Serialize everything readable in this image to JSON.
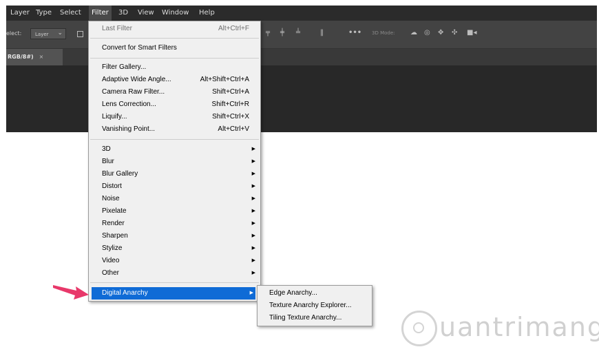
{
  "menubar": [
    "Layer",
    "Type",
    "Select",
    "Filter",
    "3D",
    "View",
    "Window",
    "Help"
  ],
  "options_bar": {
    "select_label": "elect:",
    "select_value": "Layer",
    "mode_label": "3D Mode:"
  },
  "document_tab": {
    "label": "RGB/8#)",
    "close": "×"
  },
  "filter_menu": {
    "last_filter": {
      "label": "Last Filter",
      "shortcut": "Alt+Ctrl+F"
    },
    "convert": "Convert for Smart Filters",
    "group1": [
      {
        "label": "Filter Gallery...",
        "shortcut": ""
      },
      {
        "label": "Adaptive Wide Angle...",
        "shortcut": "Alt+Shift+Ctrl+A"
      },
      {
        "label": "Camera Raw Filter...",
        "shortcut": "Shift+Ctrl+A"
      },
      {
        "label": "Lens Correction...",
        "shortcut": "Shift+Ctrl+R"
      },
      {
        "label": "Liquify...",
        "shortcut": "Shift+Ctrl+X"
      },
      {
        "label": "Vanishing Point...",
        "shortcut": "Alt+Ctrl+V"
      }
    ],
    "group2": [
      "3D",
      "Blur",
      "Blur Gallery",
      "Distort",
      "Noise",
      "Pixelate",
      "Render",
      "Sharpen",
      "Stylize",
      "Video",
      "Other"
    ],
    "highlighted": "Digital Anarchy"
  },
  "submenu": [
    "Edge Anarchy...",
    "Texture Anarchy Explorer...",
    "Tiling Texture Anarchy..."
  ],
  "watermark": "uantrimang",
  "colors": {
    "highlight": "#0f6bd6",
    "pointer": "#e8386a"
  }
}
